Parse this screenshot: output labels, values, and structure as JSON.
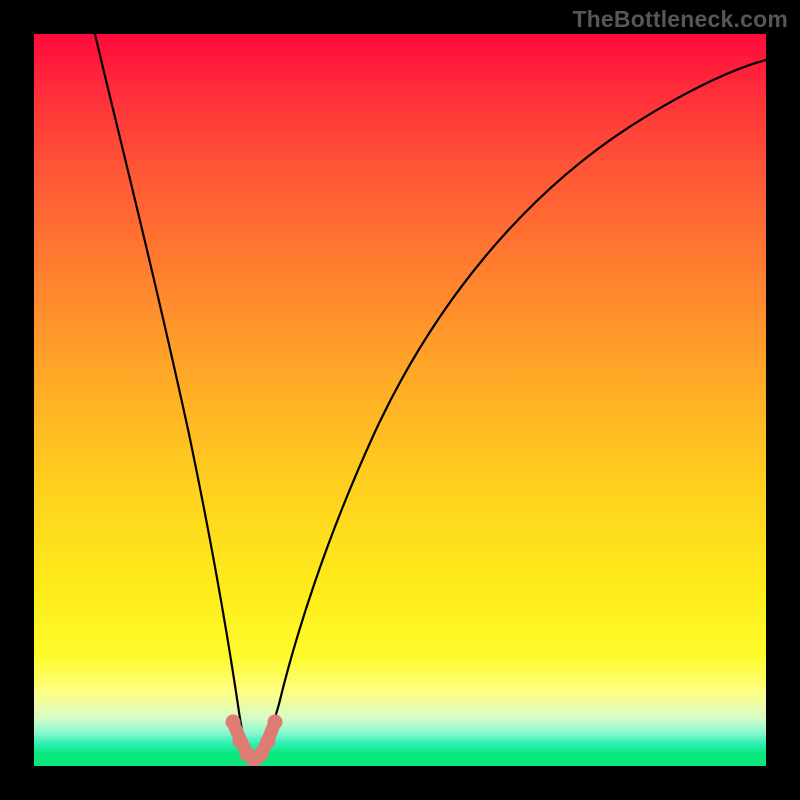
{
  "watermark": "TheBottleneck.com",
  "colors": {
    "frame_bg_top": "#ff0a3b",
    "frame_bg_bottom": "#09e87e",
    "curve_stroke": "#000000",
    "dot_fill": "#de7c73",
    "page_bg": "#000000",
    "watermark_color": "#565656"
  },
  "chart_data": {
    "type": "line",
    "title": "",
    "xlabel": "",
    "ylabel": "",
    "xlim": [
      0,
      100
    ],
    "ylim": [
      0,
      100
    ],
    "grid": false,
    "legend": false,
    "description": "V-shaped curve descending steeply from top-left, reaching a minimum near x≈29 at the bottom, then rising on a shallower arc toward the right edge.",
    "series": [
      {
        "name": "curve",
        "x": [
          8,
          10,
          14,
          18,
          22,
          25,
          27,
          28,
          29,
          30,
          31,
          33,
          36,
          40,
          46,
          54,
          64,
          76,
          88,
          100
        ],
        "y": [
          100,
          86,
          66,
          48,
          30,
          15,
          6,
          2,
          0.5,
          1.5,
          4,
          10,
          20,
          32,
          46,
          60,
          72,
          82,
          89,
          93
        ]
      }
    ],
    "highlight_points": {
      "name": "minimum-cluster",
      "x": [
        26.5,
        27.5,
        28.3,
        29.0,
        29.8,
        30.8,
        31.8
      ],
      "y": [
        6.5,
        3.5,
        1.5,
        0.6,
        1.2,
        3.0,
        5.8
      ]
    }
  }
}
